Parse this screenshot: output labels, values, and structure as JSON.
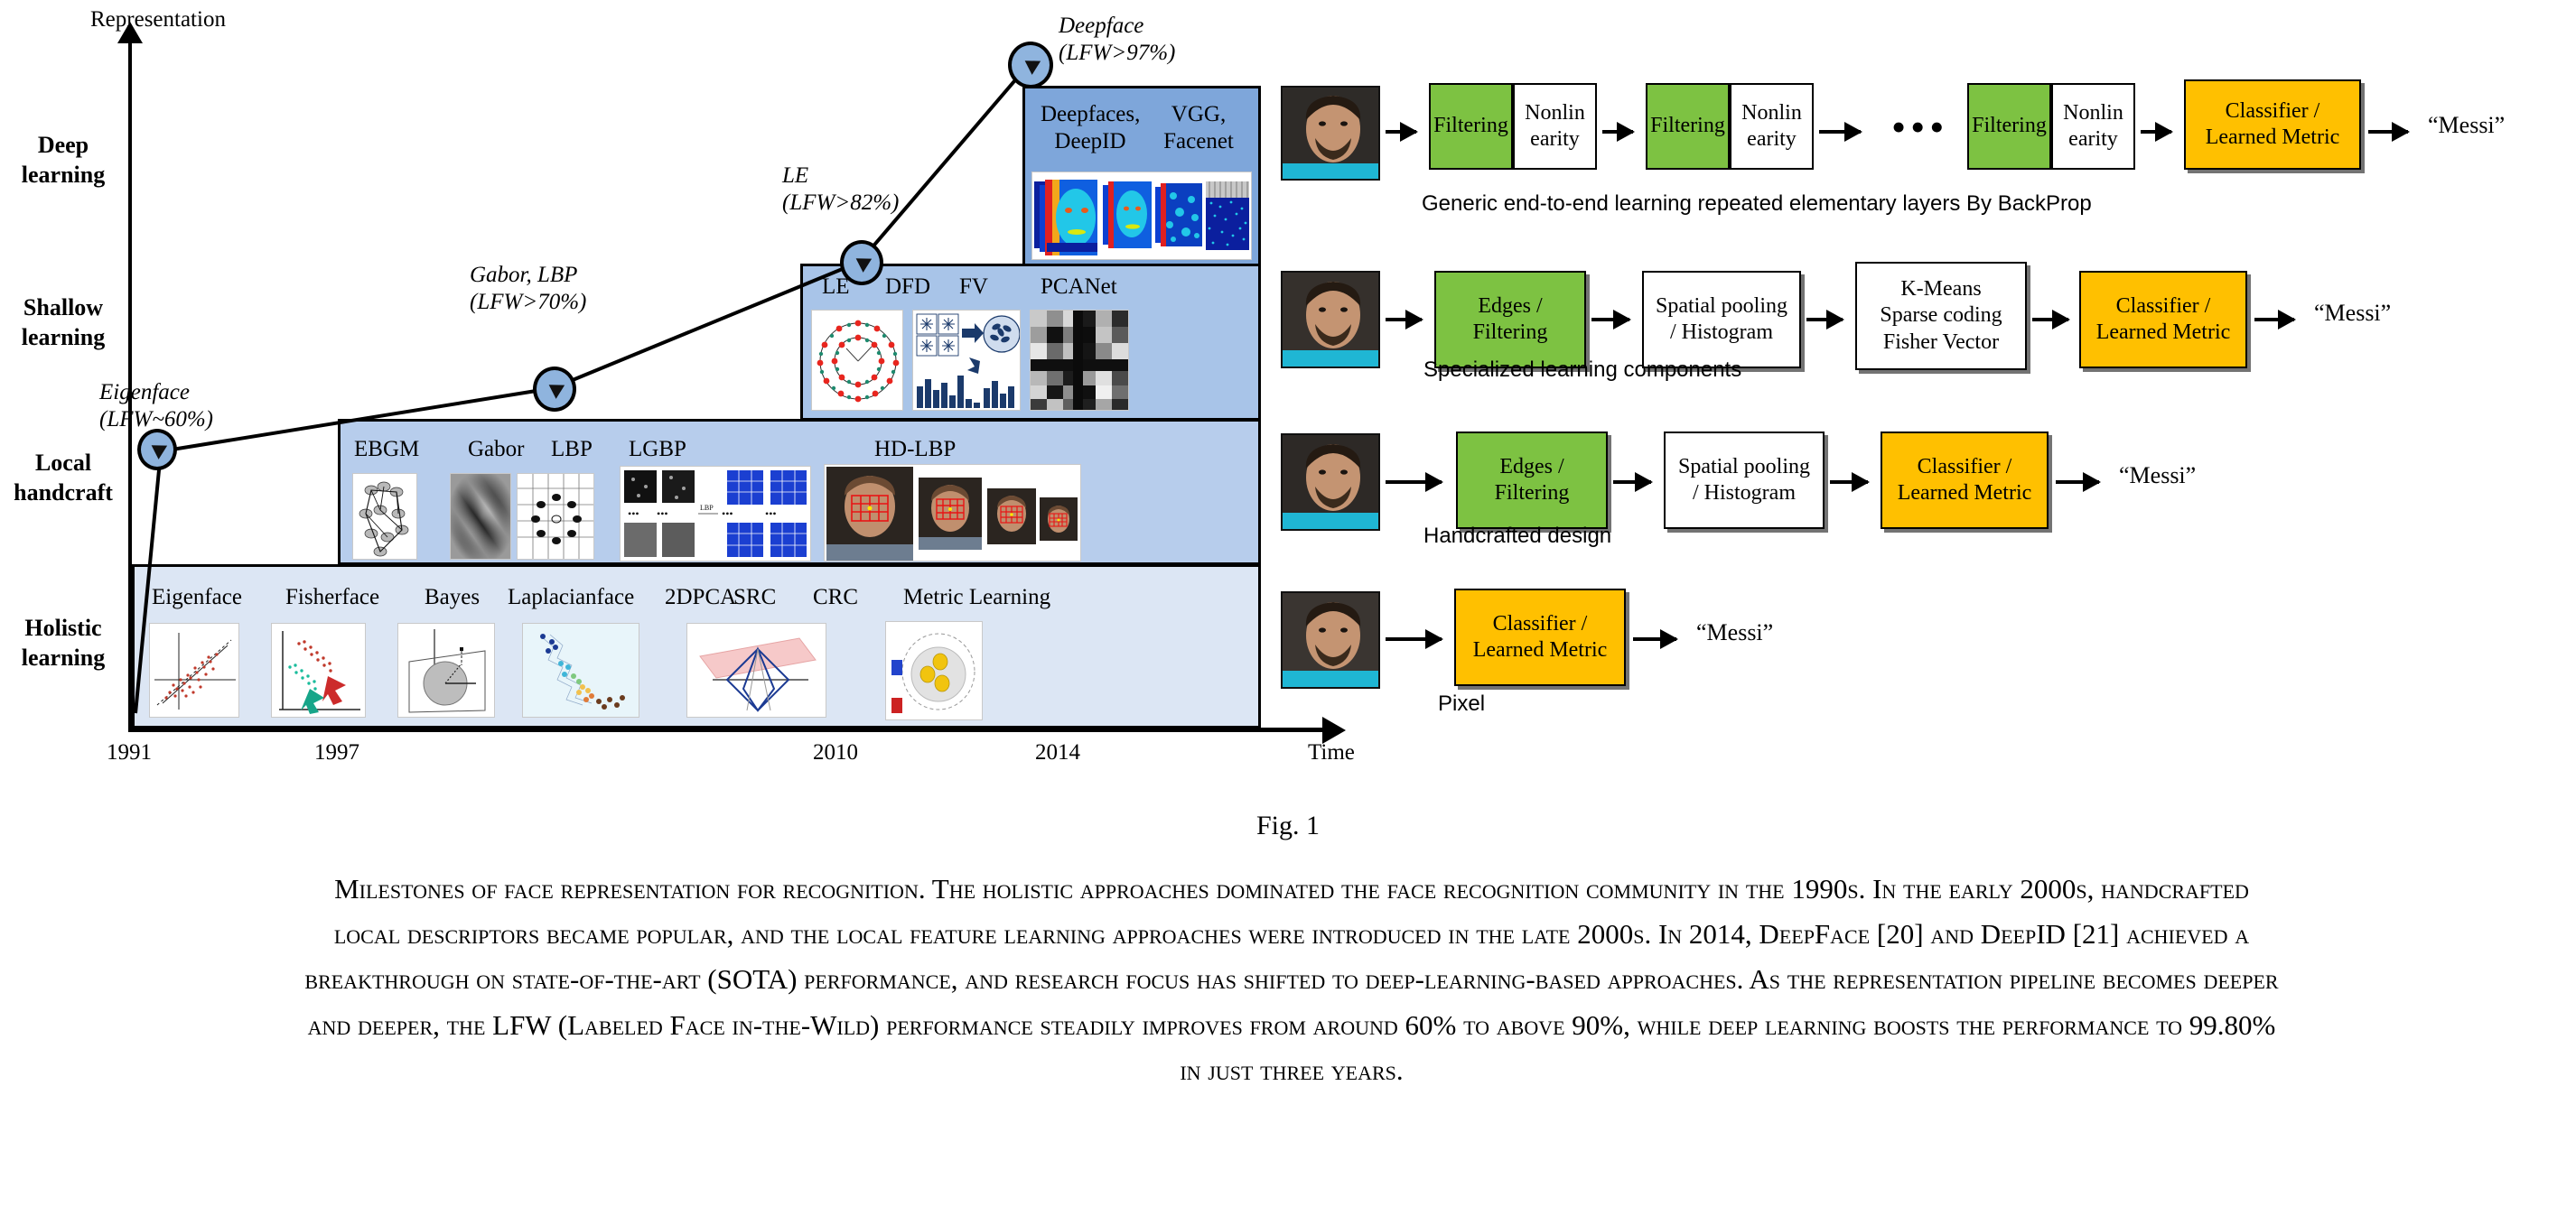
{
  "axes": {
    "y_label": "Representation",
    "x_label": "Time",
    "y_categories": [
      "Deep learning",
      "Shallow learning",
      "Local handcraft",
      "Holistic learning"
    ],
    "x_ticks": [
      "1991",
      "1997",
      "2010",
      "2014"
    ]
  },
  "milestones": [
    {
      "name": "Eigenface",
      "accuracy": "(LFW~60%)",
      "year": 1991,
      "lfw": 60
    },
    {
      "name": "Gabor, LBP",
      "accuracy": "(LFW>70%)",
      "year": 1997,
      "lfw": 70
    },
    {
      "name": "LE",
      "accuracy": "(LFW>82%)",
      "year": 2010,
      "lfw": 82
    },
    {
      "name": "Deepface",
      "accuracy": "(LFW>97%)",
      "year": 2014,
      "lfw": 97
    }
  ],
  "bands": [
    {
      "id": "deep-learning",
      "label": "Deep learning",
      "methods": [
        "Deepfaces, DeepID",
        "VGG, Facenet"
      ]
    },
    {
      "id": "shallow-learning",
      "label": "Shallow learning",
      "methods": [
        "LE",
        "DFD",
        "FV",
        "PCANet"
      ]
    },
    {
      "id": "local-handcraft",
      "label": "Local handcraft",
      "methods": [
        "EBGM",
        "Gabor",
        "LBP",
        "LGBP",
        "HD-LBP"
      ]
    },
    {
      "id": "holistic-learning",
      "label": "Holistic learning",
      "methods": [
        "Eigenface",
        "Fisherface",
        "Bayes",
        "Laplacianface",
        "2DPCA",
        "SRC",
        "CRC",
        "Metric Learning"
      ]
    }
  ],
  "pipelines": [
    {
      "id": "deep-learning-pipeline",
      "caption": "Generic end-to-end learning repeated elementary layers By BackProp",
      "output": "“Messi”",
      "stages": [
        {
          "type": "split",
          "left": "Filtering",
          "right": "Nonlin earity",
          "left_color": "#7DC242",
          "right_color": "#FFFFFF"
        },
        {
          "type": "split",
          "left": "Filtering",
          "right": "Nonlin earity",
          "left_color": "#7DC242",
          "right_color": "#FFFFFF"
        },
        {
          "type": "ellipsis",
          "label": "•••"
        },
        {
          "type": "split",
          "left": "Filtering",
          "right": "Nonlin earity",
          "left_color": "#7DC242",
          "right_color": "#FFFFFF"
        },
        {
          "type": "block",
          "label": "Classifier / Learned Metric",
          "color": "#FFC000"
        }
      ]
    },
    {
      "id": "shallow-learning-pipeline",
      "caption": "Specialized learning components",
      "output": "“Messi”",
      "stages": [
        {
          "type": "block",
          "label": "Edges / Filtering",
          "color": "#7DC242"
        },
        {
          "type": "block",
          "label": "Spatial pooling / Histogram",
          "color": "#FFFFFF"
        },
        {
          "type": "block",
          "label": "K-Means Sparse coding Fisher Vector",
          "color": "#FFFFFF"
        },
        {
          "type": "block",
          "label": "Classifier / Learned Metric",
          "color": "#FFC000"
        }
      ]
    },
    {
      "id": "local-handcraft-pipeline",
      "caption": "Handcrafted design",
      "output": "“Messi”",
      "stages": [
        {
          "type": "block",
          "label": "Edges / Filtering",
          "color": "#7DC242"
        },
        {
          "type": "block",
          "label": "Spatial pooling / Histogram",
          "color": "#FFFFFF"
        },
        {
          "type": "block",
          "label": "Classifier / Learned Metric",
          "color": "#FFC000"
        }
      ]
    },
    {
      "id": "holistic-learning-pipeline",
      "caption": "Pixel",
      "output": "“Messi”",
      "stages": [
        {
          "type": "block",
          "label": "Classifier / Learned Metric",
          "color": "#FFC000"
        }
      ]
    }
  ],
  "pipeline_labels": {
    "filtering": "Filtering",
    "nonlinearity_line1": "Nonlin",
    "nonlinearity_line2": "earity",
    "edges_line1": "Edges /",
    "edges_line2": "Filtering",
    "pooling_line1": "Spatial pooling",
    "pooling_line2": "/ Histogram",
    "kmeans_line1": "K-Means",
    "kmeans_line2": "Sparse coding",
    "kmeans_line3": "Fisher Vector",
    "classifier_line1": "Classifier /",
    "classifier_line2": "Learned Metric",
    "ellipsis": "•••",
    "output": "“Messi”"
  },
  "figure": {
    "number": "Fig. 1",
    "caption": "Milestones of face representation for recognition. The holistic approaches dominated the face recognition community in the 1990s. In the early 2000s, handcrafted local descriptors became popular, and the local feature learning approaches were introduced in the late 2000s. In 2014, DeepFace [20] and DeepID [21] achieved a breakthrough on state-of-the-art (SOTA) performance, and research focus has shifted to deep-learning-based approaches. As the representation pipeline becomes deeper and deeper, the LFW (Labeled Face in-the-Wild) performance steadily improves from around 60% to above 90%, while deep learning boosts the performance to 99.80% in just three years."
  },
  "chart_data": {
    "type": "line",
    "title": "Milestones of face representation for recognition",
    "xlabel": "Time",
    "ylabel": "Representation",
    "x": [
      1991,
      1997,
      2010,
      2014
    ],
    "values": [
      60,
      70,
      82,
      97
    ],
    "point_labels": [
      "Eigenface (LFW~60%)",
      "Gabor, LBP (LFW>70%)",
      "LE (LFW>82%)",
      "Deepface (LFW>97%)"
    ],
    "y_categories": [
      "Holistic learning",
      "Local handcraft",
      "Shallow learning",
      "Deep learning"
    ],
    "grid": false,
    "legend": "none"
  },
  "colors": {
    "green": "#7DC242",
    "orange": "#FFC000",
    "band_deep": "#7EA6DA",
    "band_shallow": "#A8C4E8",
    "band_local": "#B7CDEC",
    "band_holistic": "#DCE6F4",
    "node_fill": "#8FB4DE"
  }
}
